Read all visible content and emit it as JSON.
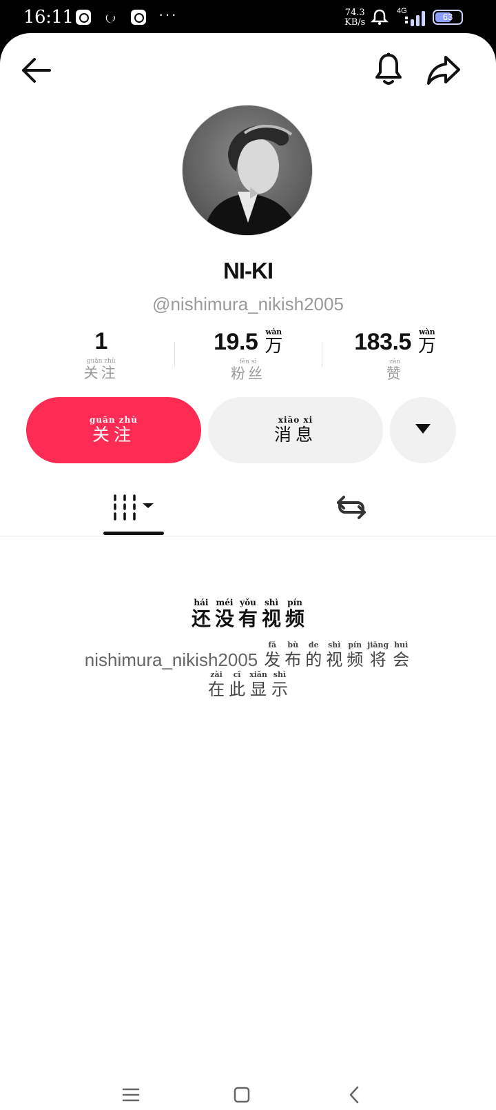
{
  "status_bar": {
    "time": "16:11",
    "more": "···",
    "net_speed_value": "74.3",
    "net_speed_unit": "KB/s",
    "network": "4G",
    "battery": "63",
    "battery_level_percent": 63
  },
  "header": {
    "back_icon": "arrow-left-icon",
    "bell_icon": "bell-icon",
    "share_icon": "share-arrow-icon"
  },
  "profile": {
    "nickname": "NI-KI",
    "handle": "@nishimura_nikish2005"
  },
  "stats": [
    {
      "value": "1",
      "unit_pinyin": "",
      "unit": "",
      "label_pinyin": "guān zhù",
      "label": "关注"
    },
    {
      "value": "19.5",
      "unit_pinyin": "wàn",
      "unit": "万",
      "label_pinyin": "fěn sī",
      "label": "粉丝"
    },
    {
      "value": "183.5",
      "unit_pinyin": "wàn",
      "unit": "万",
      "label_pinyin": "zàn",
      "label": "赞"
    }
  ],
  "actions": {
    "follow_pinyin": "guān zhù",
    "follow": "关注",
    "message_pinyin": "xiāo xi",
    "message": "消息",
    "more_icon": "caret-down-icon"
  },
  "tabs": {
    "videos_icon": "grid-bars-icon",
    "reposts_icon": "repost-icon"
  },
  "empty_state": {
    "title": [
      {
        "py": "hái",
        "hz": "还"
      },
      {
        "py": "méi",
        "hz": "没"
      },
      {
        "py": "yǒu",
        "hz": "有"
      },
      {
        "py": "shì",
        "hz": "视"
      },
      {
        "py": "pín",
        "hz": "频"
      }
    ],
    "username": "nishimura_nikish2005",
    "desc_line1": [
      {
        "py": "fā",
        "hz": "发"
      },
      {
        "py": "bù",
        "hz": "布"
      },
      {
        "py": "de",
        "hz": "的"
      },
      {
        "py": "shì",
        "hz": "视"
      },
      {
        "py": "pín",
        "hz": "频"
      },
      {
        "py": "jiāng",
        "hz": "将"
      },
      {
        "py": "huì",
        "hz": "会"
      }
    ],
    "desc_line2": [
      {
        "py": "zài",
        "hz": "在"
      },
      {
        "py": "cǐ",
        "hz": "此"
      },
      {
        "py": "xiǎn",
        "hz": "显"
      },
      {
        "py": "shì",
        "hz": "示"
      }
    ]
  },
  "colors": {
    "accent": "#fe2c55",
    "button_grey": "#f1f1f2",
    "muted_text": "#9a9a9a"
  }
}
